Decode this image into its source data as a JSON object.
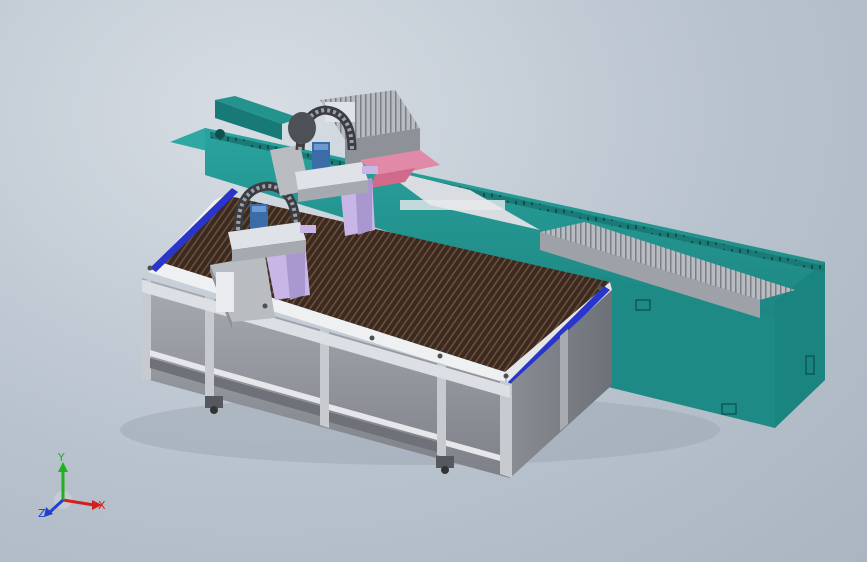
{
  "viewport": {
    "background_top": "#d7dde4",
    "background_bottom": "#aab5c1"
  },
  "colors": {
    "teal_body": "#1f8f8b",
    "teal_dark": "#156b68",
    "teal_light": "#2fa8a3",
    "frame_gray": "#8f9399",
    "frame_light": "#c9ccd1",
    "frame_dark": "#5f6368",
    "blue_rail": "#2a35c9",
    "bed_dark": "#3a2a22",
    "lavender": "#c8b7e6",
    "pink": "#e08aa8"
  },
  "triad": {
    "x_label": "X",
    "y_label": "Y",
    "z_label": "Z",
    "x_color": "#d02020",
    "y_color": "#20b020",
    "z_color": "#2040d0"
  }
}
